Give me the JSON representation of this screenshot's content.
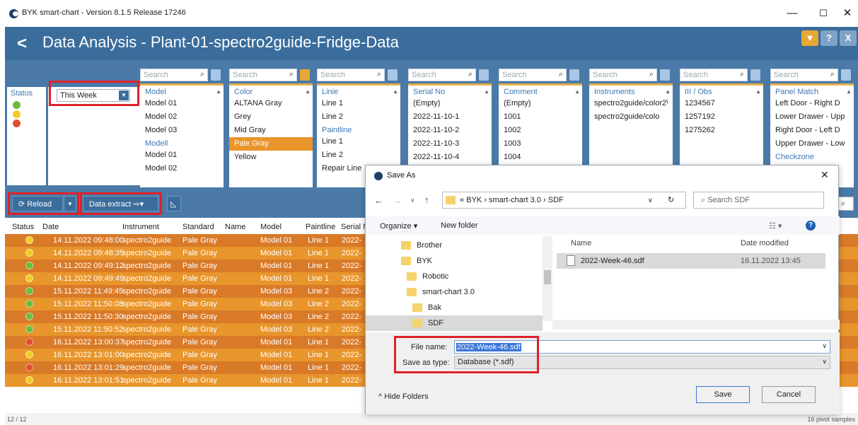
{
  "window": {
    "title": "BYK smart-chart - Version 8.1.5 Release 17246",
    "minimize": "—",
    "maximize": "☐",
    "close": "✕"
  },
  "header": {
    "back": "<",
    "title": "Data Analysis - Plant-01-spectro2guide-Fridge-Data",
    "filter_btn": "▼",
    "help_btn": "?",
    "close_btn": "X"
  },
  "filters": {
    "search_placeholder": "Search",
    "status": {
      "header": "Status",
      "colors": [
        "#6dbb3c",
        "#f1cc28",
        "#e0502a"
      ]
    },
    "period": {
      "value": "This Week"
    },
    "model": {
      "header": "Model",
      "items": [
        "Model 01",
        "Model 02",
        "Model 03"
      ],
      "header2": "Modell",
      "items2": [
        "Model 01",
        "Model 02"
      ]
    },
    "color": {
      "header": "Color",
      "items": [
        "ALTANA Gray",
        "Grey",
        "Mid Gray",
        "Pale Gray",
        "Yellow"
      ],
      "selected": "Pale Gray"
    },
    "linie": {
      "header": "Linie",
      "items": [
        "Line 1",
        "Line 2"
      ],
      "header2": "Paintline",
      "items2": [
        "Line 1",
        "Line 2",
        "Repair Line"
      ]
    },
    "serial": {
      "header": "Serial No",
      "items": [
        "(Empty)",
        "2022-11-10-1",
        "2022-11-10-2",
        "2022-11-10-3",
        "2022-11-10-4"
      ]
    },
    "comment": {
      "header": "Comment",
      "items": [
        "(Empty)",
        "1001",
        "1002",
        "1003",
        "1004"
      ]
    },
    "instruments": {
      "header": "Instruments",
      "items": [
        "spectro2guide/color2\\",
        "spectro2guide/colo"
      ]
    },
    "obs": {
      "header": "III / Obs",
      "items": [
        "1234567",
        "1257192",
        "1275262"
      ]
    },
    "panel": {
      "header": "Panel Match",
      "items": [
        "Left Door - Right D",
        "Lower Drawer - Upp",
        "Right Door - Left D",
        "Upper Drawer - Low"
      ],
      "header2": "Checkzone"
    }
  },
  "toolbar": {
    "reload": "Reload",
    "data_extract": "Data extract",
    "search_placeholder": "Search"
  },
  "table": {
    "columns": [
      "Status",
      "Date",
      "Instrument",
      "Standard",
      "Name",
      "Model",
      "Paintline",
      "Serial N"
    ],
    "rows": [
      {
        "status": "#f1cc28",
        "date": "14.11.2022 09:48:00",
        "instrument": "spectro2guide",
        "standard": "Pale Gray",
        "model": "Model 01",
        "line": "Line 1",
        "serial": "2022-"
      },
      {
        "status": "#f1cc28",
        "date": "14.11.2022 09:48:35",
        "instrument": "spectro2guide",
        "standard": "Pale Gray",
        "model": "Model 01",
        "line": "Line 1",
        "serial": "2022-"
      },
      {
        "status": "#6dbb3c",
        "date": "14.11.2022 09:49:12",
        "instrument": "spectro2guide",
        "standard": "Pale Gray",
        "model": "Model 01",
        "line": "Line 1",
        "serial": "2022-"
      },
      {
        "status": "#f1cc28",
        "date": "14.11.2022 09:49:49",
        "instrument": "spectro2guide",
        "standard": "Pale Gray",
        "model": "Model 01",
        "line": "Line 1",
        "serial": "2022-"
      },
      {
        "status": "#6dbb3c",
        "date": "15.11.2022 11:49:45",
        "instrument": "spectro2guide",
        "standard": "Pale Gray",
        "model": "Model 03",
        "line": "Line 2",
        "serial": "2022-"
      },
      {
        "status": "#6dbb3c",
        "date": "15.11.2022 11:50:08",
        "instrument": "spectro2guide",
        "standard": "Pale Gray",
        "model": "Model 03",
        "line": "Line 2",
        "serial": "2022-"
      },
      {
        "status": "#6dbb3c",
        "date": "15.11.2022 11:50:30",
        "instrument": "spectro2guide",
        "standard": "Pale Gray",
        "model": "Model 03",
        "line": "Line 2",
        "serial": "2022-"
      },
      {
        "status": "#6dbb3c",
        "date": "15.11.2022 11:50:52",
        "instrument": "spectro2guide",
        "standard": "Pale Gray",
        "model": "Model 03",
        "line": "Line 2",
        "serial": "2022-"
      },
      {
        "status": "#e0502a",
        "date": "16.11.2022 13:00:37",
        "instrument": "spectro2guide",
        "standard": "Pale Gray",
        "model": "Model 01",
        "line": "Line 1",
        "serial": "2022-"
      },
      {
        "status": "#f1cc28",
        "date": "16.11.2022 13:01:00",
        "instrument": "spectro2guide",
        "standard": "Pale Gray",
        "model": "Model 01",
        "line": "Line 1",
        "serial": "2022-"
      },
      {
        "status": "#e0502a",
        "date": "16.11.2022 13:01:29",
        "instrument": "spectro2guide",
        "standard": "Pale Gray",
        "model": "Model 01",
        "line": "Line 1",
        "serial": "2022-"
      },
      {
        "status": "#f1cc28",
        "date": "16.11.2022 13:01:51",
        "instrument": "spectro2guide",
        "standard": "Pale Gray",
        "model": "Model 01",
        "line": "Line 1",
        "serial": "2022-"
      }
    ]
  },
  "statusbar": {
    "count": "12 / 12",
    "samples": "16 pivot samples"
  },
  "dialog": {
    "title": "Save As",
    "close": "✕",
    "breadcrumb": [
      "BYK",
      "smart-chart 3.0",
      "SDF"
    ],
    "search_placeholder": "Search SDF",
    "organize": "Organize",
    "new_folder": "New folder",
    "tree": [
      "Brother",
      "BYK",
      "Robotic",
      "smart-chart 3.0",
      "Bak",
      "SDF"
    ],
    "col_name": "Name",
    "col_date": "Date modified",
    "files": [
      {
        "name": "2022-Week-46.sdf",
        "date": "16.11.2022 13:45"
      }
    ],
    "file_name_label": "File name:",
    "file_name_value": "2022-Week-46.sdf",
    "save_type_label": "Save as type:",
    "save_type_value": "Database (*.sdf)",
    "hide_folders": "Hide Folders",
    "save": "Save",
    "cancel": "Cancel"
  },
  "colors": {
    "accent": "#3a6d9c",
    "row_dark": "#d97a28",
    "row_light": "#e8952c",
    "highlight_red": "#e0202a"
  }
}
